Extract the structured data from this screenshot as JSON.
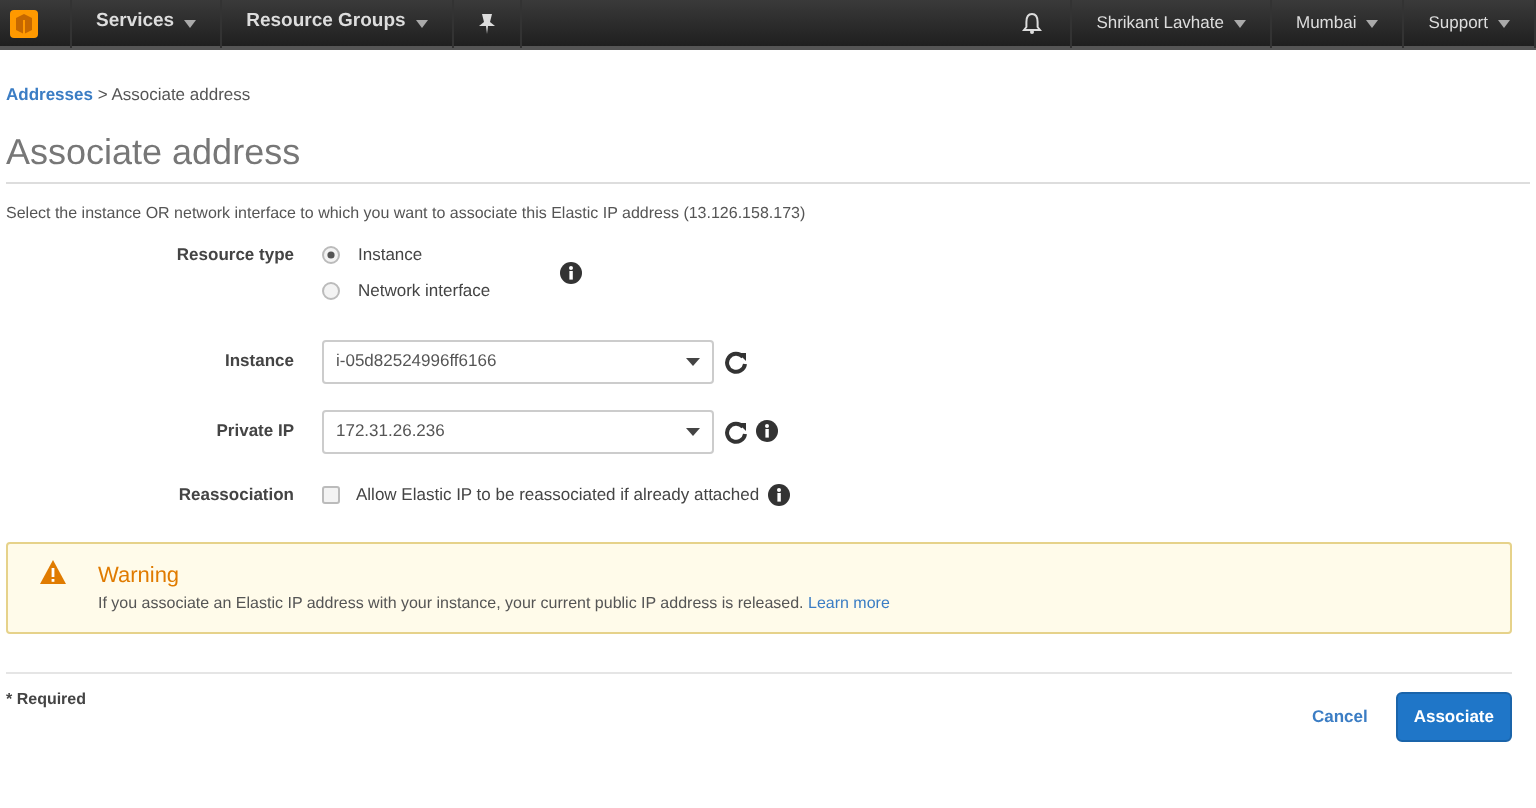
{
  "navbar": {
    "menus": [
      {
        "label": "Services"
      },
      {
        "label": "Resource Groups"
      }
    ],
    "right_menus": [
      {
        "label": "Shrikant Lavhate"
      },
      {
        "label": "Mumbai"
      },
      {
        "label": "Support"
      }
    ]
  },
  "breadcrumb": {
    "link": "Addresses",
    "separator": ">",
    "current": "Associate address"
  },
  "title": "Associate address",
  "description": "Select the instance OR network interface to which you want to associate this Elastic IP address (13.126.158.173)",
  "form": [
    {
      "kind": "radio",
      "label": "Resource type",
      "info": true,
      "options": [
        {
          "label": "Instance",
          "selected": true
        },
        {
          "label": "Network interface",
          "selected": false
        }
      ]
    },
    {
      "kind": "select",
      "label": "Instance",
      "value": "i-05d82524996ff6166",
      "refresh": true,
      "info": false
    },
    {
      "kind": "select",
      "label": "Private IP",
      "value": "172.31.26.236",
      "refresh": true,
      "info": true
    },
    {
      "kind": "checkbox",
      "label": "Reassociation",
      "text": "Allow Elastic IP to be reassociated if already attached",
      "checked": false,
      "info": true
    }
  ],
  "warning": {
    "title": "Warning",
    "message": "If you associate an Elastic IP address with your instance, your current public IP address is released.",
    "link": "Learn more"
  },
  "footer": {
    "required": "* Required",
    "cancel": "Cancel",
    "submit": "Associate"
  }
}
